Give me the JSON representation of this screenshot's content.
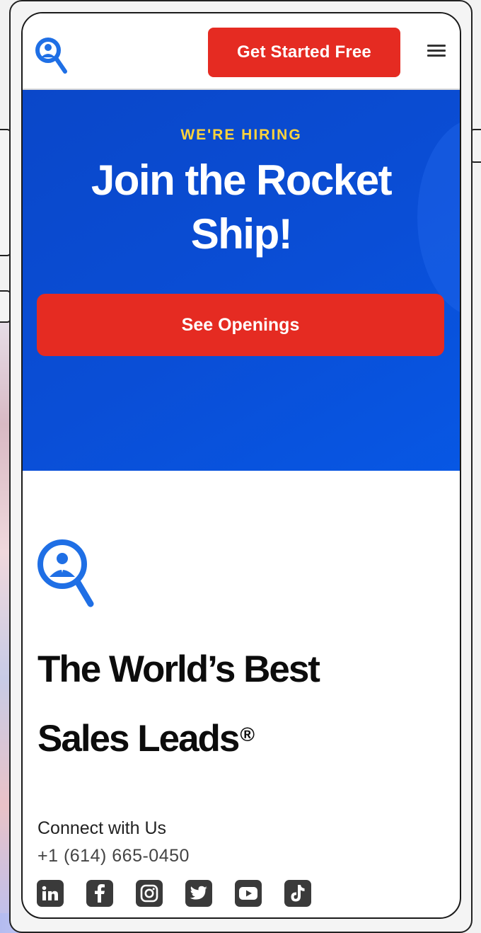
{
  "header": {
    "cta_label": "Get Started Free",
    "logo_icon": "magnifier-user-logo-icon",
    "menu_icon": "hamburger-menu-icon"
  },
  "hero": {
    "eyebrow": "WE'RE HIRING",
    "title_line1": "Join the Rocket",
    "title_line2": "Ship!",
    "button_label": "See Openings"
  },
  "footer": {
    "tagline_line1": "The World’s Best",
    "tagline_line2": "Sales Leads",
    "tagline_mark": "®",
    "connect_label": "Connect with Us",
    "phone": "+1 (614) 665-0450",
    "social_icons": [
      "linkedin-icon",
      "facebook-icon",
      "instagram-icon",
      "twitter-icon",
      "youtube-icon",
      "tiktok-icon"
    ]
  },
  "colors": {
    "brand_blue": "#0a4ed6",
    "accent_red": "#e52b22",
    "eyebrow_yellow": "#ffd43b"
  }
}
